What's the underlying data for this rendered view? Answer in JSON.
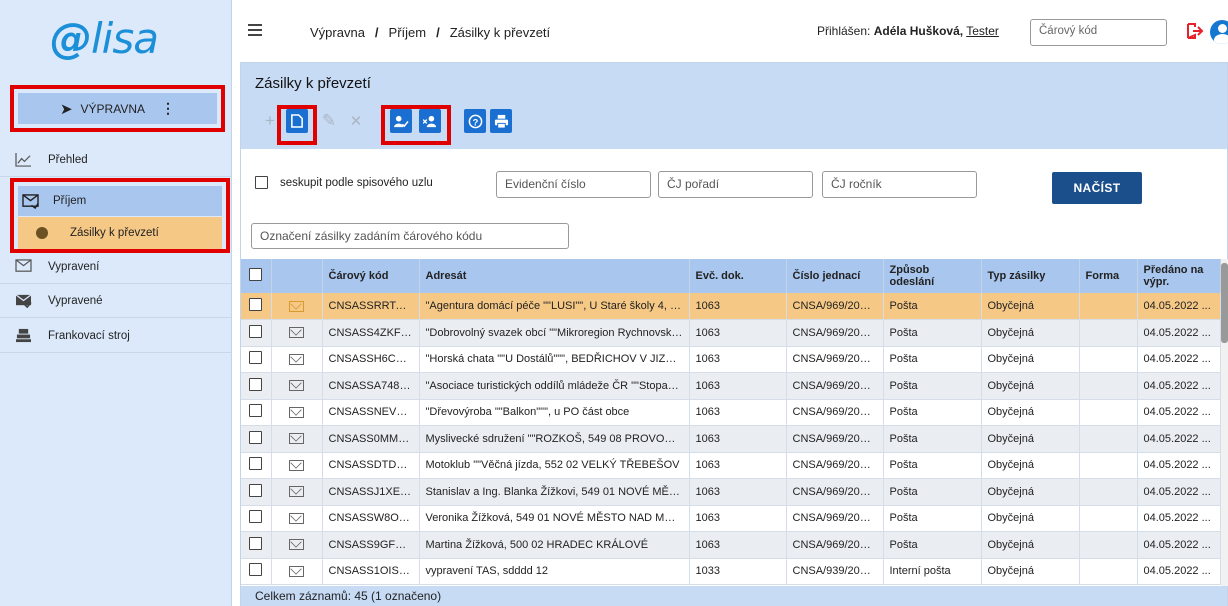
{
  "app": {
    "logo": "elisa"
  },
  "module": {
    "label": "VÝPRAVNA"
  },
  "sidebar": {
    "items": [
      {
        "label": "Přehled",
        "icon": "chart-line-icon"
      },
      {
        "label": "Příjem",
        "icon": "inbox-icon"
      },
      {
        "label": "Zásilky k převzetí",
        "icon": "dot-icon"
      },
      {
        "label": "Vypravení",
        "icon": "outbox-icon"
      },
      {
        "label": "Vypravené",
        "icon": "mail-check-icon"
      },
      {
        "label": "Frankovací stroj",
        "icon": "franking-machine-icon"
      }
    ]
  },
  "header": {
    "breadcrumbs": [
      "Výpravna",
      "Příjem",
      "Zásilky k převzetí"
    ],
    "separator": "/",
    "login_prefix": "Přihlášen:",
    "user_name": "Adéla Hušková,",
    "user_role": "Tester",
    "barcode_placeholder": "Čárový kód"
  },
  "page": {
    "title": "Zásilky k převzetí"
  },
  "filters": {
    "group_label": "seskupit podle spisového uzlu",
    "evidence_placeholder": "Evidenční číslo",
    "cj_order_placeholder": "ČJ pořadí",
    "cj_year_placeholder": "ČJ ročník",
    "load_button": "NAČÍST",
    "barcode_mark_placeholder": "Označení zásilky zadáním čárového kódu"
  },
  "table": {
    "columns": [
      "",
      "",
      "Čárový kód",
      "Adresát",
      "Evč. dok.",
      "Číslo jednací",
      "Způsob odeslání",
      "Typ zásilky",
      "Forma",
      "Předáno na výpr."
    ],
    "rows": [
      [
        "CNSASSRRTAD8...",
        "\"Agentura domácí péče \"\"LUSI\"\", U Staré školy 4, Praha ...",
        "1063",
        "CNSA/969/2022...",
        "Pošta",
        "Obyčejná",
        "",
        "04.05.2022 ..."
      ],
      [
        "CNSASS4ZKFF869",
        "\"Dobrovolný svazek obcí \"\"Mikroregion Rychnovsko\"\"\" 3...",
        "1063",
        "CNSA/969/2022...",
        "Pošta",
        "Obyčejná",
        "",
        "04.05.2022 ..."
      ],
      [
        "CNSASSH6CKH8...",
        "\"Horská chata \"\"U Dostálů\"\"\", BEDŘICHOV V JIZERSKÝC...",
        "1063",
        "CNSA/969/2022...",
        "Pošta",
        "Obyčejná",
        "",
        "04.05.2022 ..."
      ],
      [
        "CNSASSA748S8...",
        "\"Asociace turistických oddílů mládeže ČR \"\"Stopa\"\" Nov...",
        "1063",
        "CNSA/969/2022...",
        "Pošta",
        "Obyčejná",
        "",
        "04.05.2022 ..."
      ],
      [
        "CNSASSNEVCU8...",
        "\"Dřevovýroba \"\"Balkon\"\"\", u PO část obce",
        "1063",
        "CNSA/969/2022...",
        "Pošta",
        "Obyčejná",
        "",
        "04.05.2022 ..."
      ],
      [
        "CNSASS0MMHW...",
        "Myslivecké sdružení \"\"ROZKOŠ, 549 08 PROVODOV - Š...",
        "1063",
        "CNSA/969/2022...",
        "Pošta",
        "Obyčejná",
        "",
        "04.05.2022 ..."
      ],
      [
        "CNSASSDTDMY...",
        "Motoklub \"\"Věčná jízda, 552 02 VELKÝ TŘEBEŠOV",
        "1063",
        "CNSA/969/2022...",
        "Pošta",
        "Obyčejná",
        "",
        "04.05.2022 ..."
      ],
      [
        "CNSASSJ1XEB9...",
        "Stanislav a Ing. Blanka Žížkovi, 549 01 NOVÉ MĚSTO N...",
        "1063",
        "CNSA/969/2022...",
        "Pošta",
        "Obyčejná",
        "",
        "04.05.2022 ..."
      ],
      [
        "CNSASSW8OJD9...",
        "Veronika Žížková, 549 01 NOVÉ MĚSTO NAD METUJÍ",
        "1063",
        "CNSA/969/2022...",
        "Pošta",
        "Obyčejná",
        "",
        "04.05.2022 ..."
      ],
      [
        "CNSASS9GFOF9...",
        "Martina Žížková, 500 02 HRADEC KRÁLOVÉ",
        "1063",
        "CNSA/969/2022...",
        "Pošta",
        "Obyčejná",
        "",
        "04.05.2022 ..."
      ],
      [
        "CNSASS1OISDA69",
        "vypravení TAS, sdddd 12",
        "1033",
        "CNSA/939/2022...",
        "Interní pošta",
        "Obyčejná",
        "",
        "04.05.2022 ..."
      ]
    ]
  },
  "footer": {
    "summary": "Celkem záznamů: 45   (1 označeno)"
  },
  "colors": {
    "accent": "#1b6fd1",
    "selected_row": "#f6c886",
    "highlight_border": "#e00000",
    "header_blue": "#a8c6ee"
  }
}
